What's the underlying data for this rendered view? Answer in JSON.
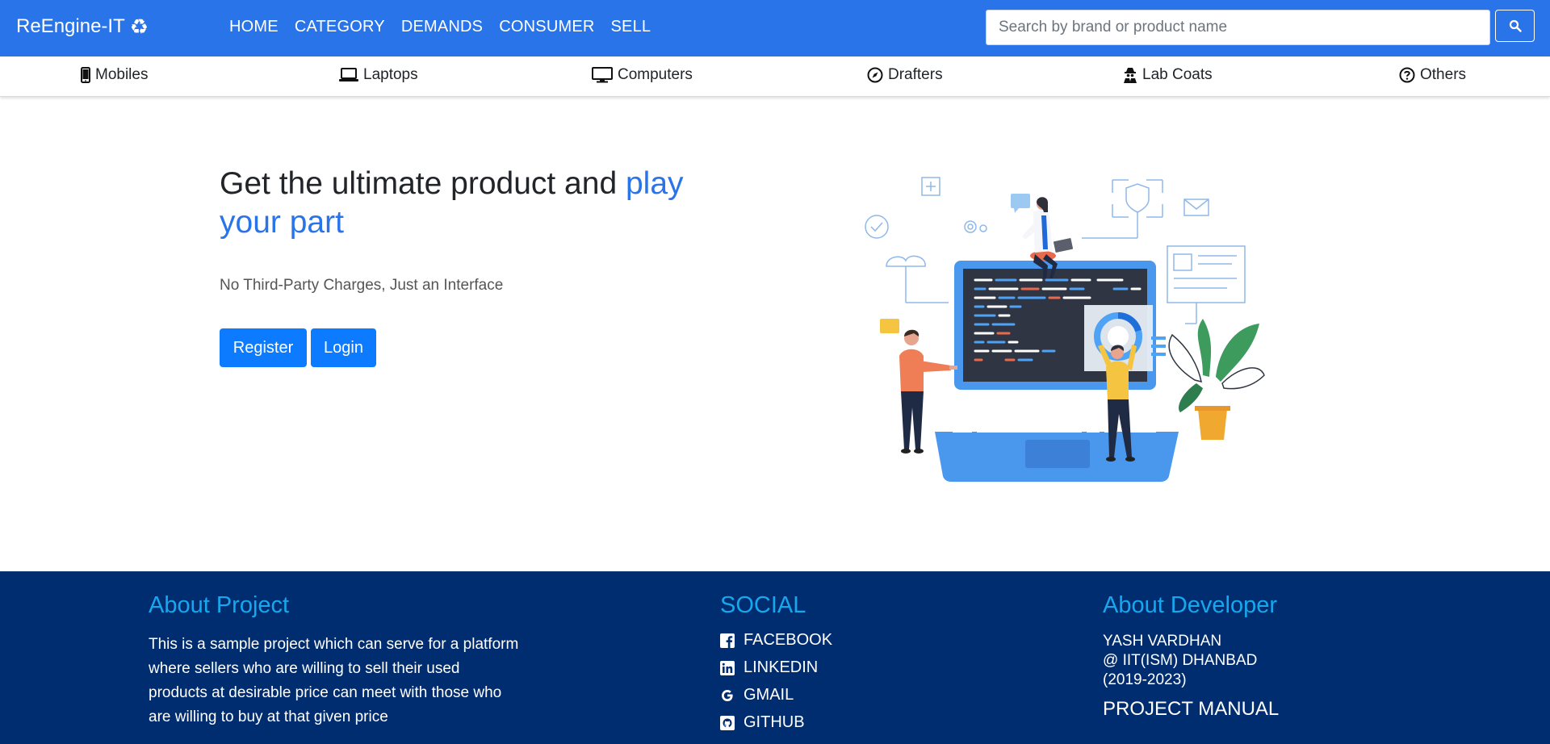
{
  "brand": {
    "name": "ReEngine-IT",
    "icon": "recycle-icon"
  },
  "nav": {
    "items": [
      "HOME",
      "CATEGORY",
      "DEMANDS",
      "CONSUMER",
      "SELL"
    ]
  },
  "search": {
    "placeholder": "Search by brand or product name",
    "value": ""
  },
  "categories": [
    {
      "label": "Mobiles",
      "icon": "mobile-phone-icon"
    },
    {
      "label": "Laptops",
      "icon": "laptop-icon"
    },
    {
      "label": "Computers",
      "icon": "desktop-monitor-icon"
    },
    {
      "label": "Drafters",
      "icon": "compass-icon"
    },
    {
      "label": "Lab Coats",
      "icon": "user-secret-icon"
    },
    {
      "label": "Others",
      "icon": "question-circle-icon"
    }
  ],
  "hero": {
    "title_plain": "Get the ultimate product and ",
    "title_accent": "play your part",
    "subtitle": "No Third-Party Charges, Just an Interface",
    "register_label": "Register",
    "login_label": "Login"
  },
  "footer": {
    "about_title": "About Project",
    "about_text": "This is a sample project which can serve for a platform where sellers who are willing to sell their used products at desirable price can meet with those who are willing to buy at that given price",
    "social_title": "SOCIAL",
    "social": [
      {
        "label": "FACEBOOK",
        "icon": "facebook-icon"
      },
      {
        "label": "LINKEDIN",
        "icon": "linkedin-icon"
      },
      {
        "label": "GMAIL",
        "icon": "google-icon"
      },
      {
        "label": "GITHUB",
        "icon": "github-icon"
      }
    ],
    "developer_title": "About Developer",
    "developer_lines": [
      "YASH VARDHAN",
      "@ IIT(ISM) DHANBAD",
      "(2019-2023)"
    ],
    "manual_label": "PROJECT MANUAL"
  },
  "colors": {
    "primary": "#2a74ea",
    "button": "#0d7bff",
    "footer_bg": "#002d6f",
    "footer_heading": "#16a8ee"
  }
}
